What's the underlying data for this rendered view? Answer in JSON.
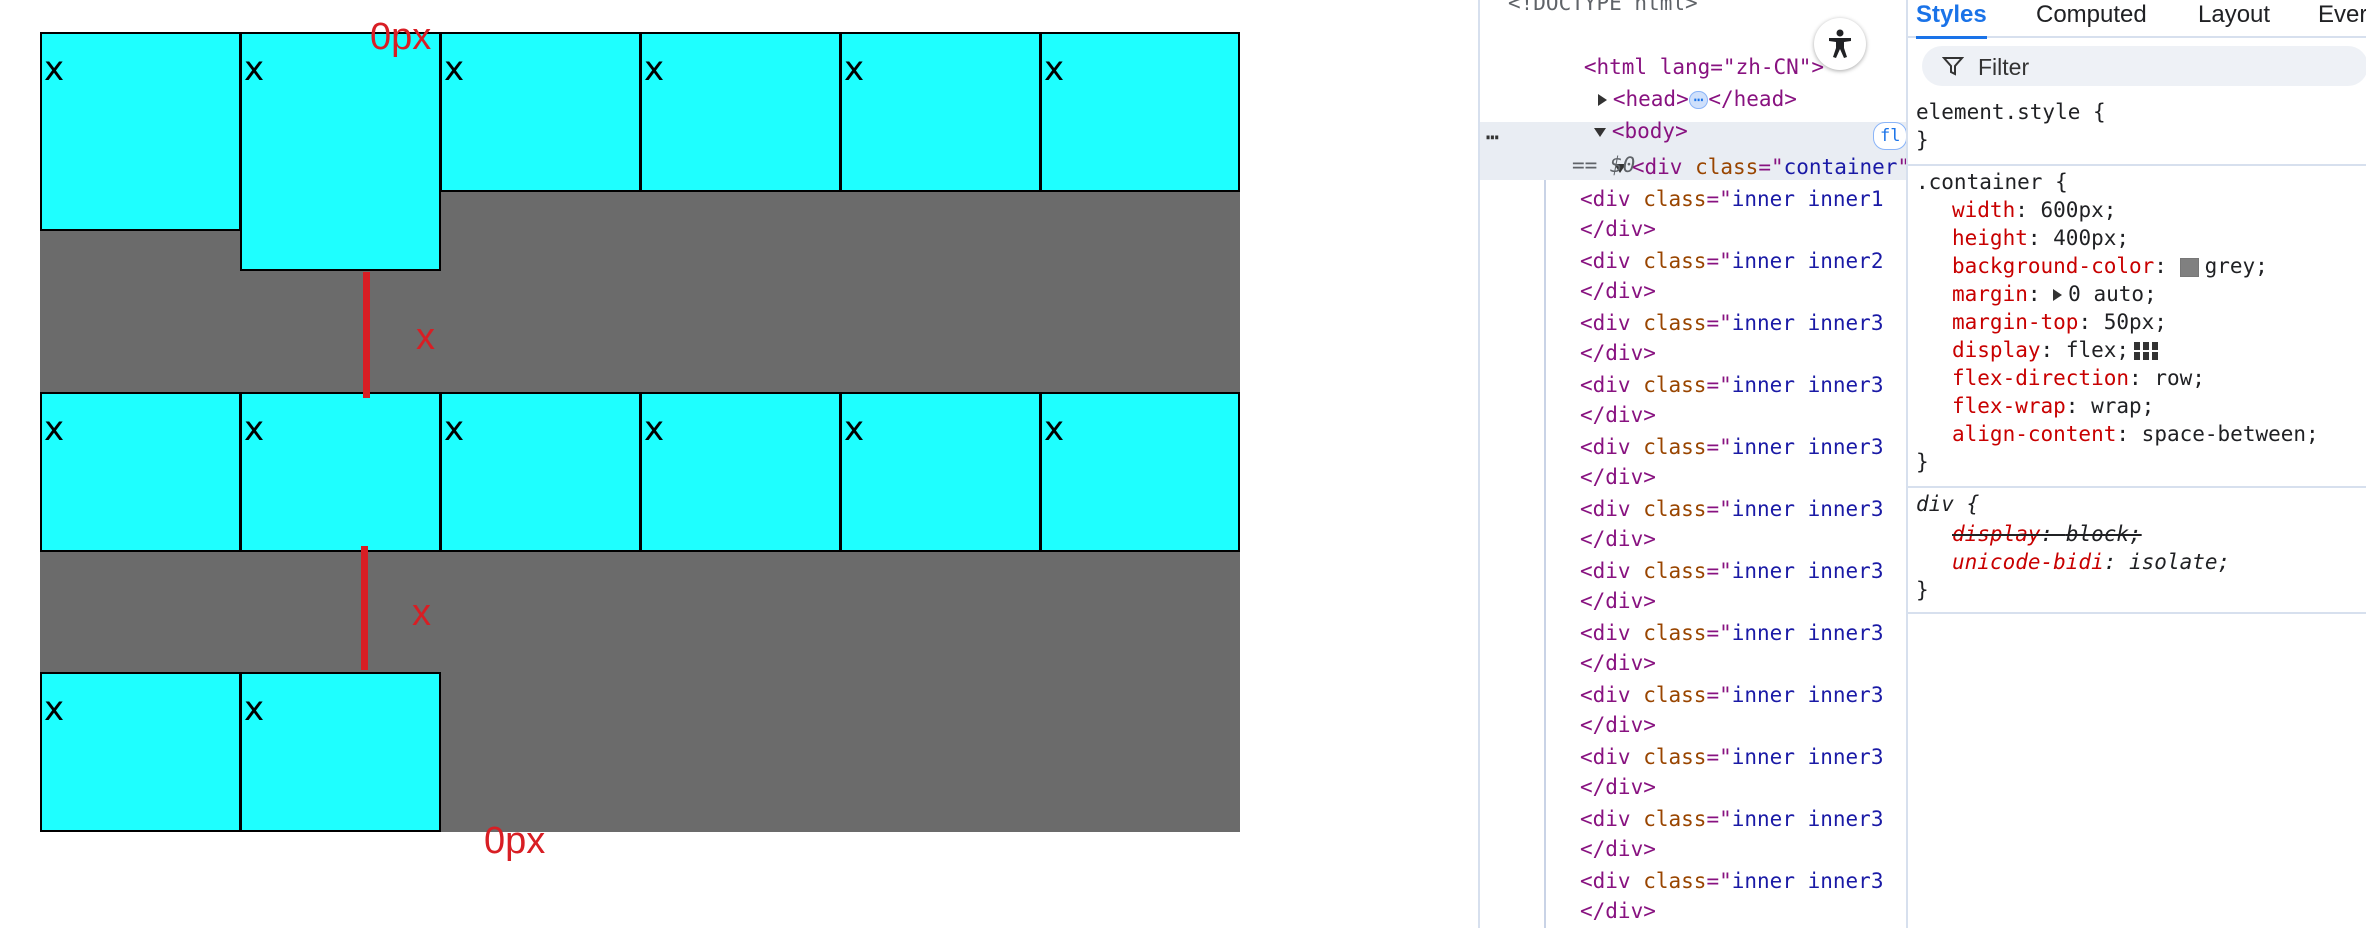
{
  "preview": {
    "cell_text": "x",
    "annotations": {
      "top_label": "0px",
      "gap1_label": "x",
      "gap2_label": "x",
      "bottom_label": "0px"
    },
    "colors": {
      "item": "#1effff",
      "container": "#6b6b6b",
      "annotation": "#d81e24"
    }
  },
  "devtools": {
    "elements": {
      "doctype": "<!DOCTYPE html>",
      "html_open": "<html lang=\"zh-CN\">",
      "head": "<head>",
      "head_close": "</head>",
      "body": "<body>",
      "container_tag": "div",
      "container_class": "container",
      "flex_badge": "fl",
      "dollar": "== $0",
      "div_close": "</div>",
      "inner_rows": [
        {
          "class": "inner inner1"
        },
        {
          "class": "inner inner2"
        },
        {
          "class": "inner inner3"
        },
        {
          "class": "inner inner3"
        },
        {
          "class": "inner inner3"
        },
        {
          "class": "inner inner3"
        },
        {
          "class": "inner inner3"
        },
        {
          "class": "inner inner3"
        },
        {
          "class": "inner inner3"
        },
        {
          "class": "inner inner3"
        },
        {
          "class": "inner inner3"
        },
        {
          "class": "inner inner3"
        }
      ]
    },
    "tabs": [
      "Styles",
      "Computed",
      "Layout",
      "Ever"
    ],
    "filter_placeholder": "Filter",
    "styles": {
      "element_style": "element.style {",
      "close_brace": "}",
      "container_selector": ".container {",
      "props": [
        {
          "name": "width",
          "value": "600px;"
        },
        {
          "name": "height",
          "value": "400px;"
        },
        {
          "name": "background-color",
          "value": "grey;"
        },
        {
          "name": "margin",
          "value": "0 auto;"
        },
        {
          "name": "margin-top",
          "value": "50px;"
        },
        {
          "name": "display",
          "value": "flex;"
        },
        {
          "name": "flex-direction",
          "value": "row;"
        },
        {
          "name": "flex-wrap",
          "value": "wrap;"
        },
        {
          "name": "align-content",
          "value": "space-between;"
        }
      ],
      "div_selector": "div {",
      "ua_props": [
        {
          "name": "display",
          "value": "block;"
        },
        {
          "name": "unicode-bidi",
          "value": "isolate;"
        }
      ]
    }
  }
}
